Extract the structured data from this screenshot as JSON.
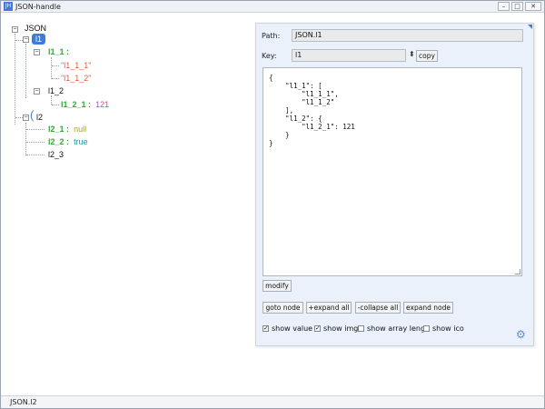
{
  "window": {
    "title": "JSON-handle",
    "icon_label": "JH",
    "buttons": {
      "minimize": "–",
      "maximize": "□",
      "close": "✕"
    }
  },
  "tree": {
    "root": "JSON",
    "l1_label": "l1",
    "l1_1": {
      "key": "l1_1",
      "colon": ":",
      "items": [
        "\"l1_1_1\"",
        "\"l1_1_2\""
      ]
    },
    "l1_2": {
      "label": "l1_2",
      "child_key": "l1_2_1",
      "colon": ":",
      "child_value": "121"
    },
    "l2_label": "l2",
    "l2_1": {
      "key": "l2_1",
      "colon": ":",
      "value": "null"
    },
    "l2_2": {
      "key": "l2_2",
      "colon": ":",
      "value": "true"
    },
    "l2_3": {
      "label": "l2_3"
    }
  },
  "panel": {
    "path_label": "Path:",
    "path_value": "JSON.l1",
    "key_label": "Key:",
    "key_value": "l1",
    "spin_glyph": "⬍",
    "copy_button": "copy",
    "editor_text": "{\n    \"l1_1\": [\n        \"l1_1_1\",\n        \"l1_1_2\"\n    ],\n    \"l1_2\": {\n        \"l1_2_1\": 121\n    }\n}",
    "modify_button": "modify",
    "goto_button": "goto node",
    "expand_all_button": "+expand all",
    "collapse_all_button": "-collapse all",
    "expand_node_button": "expand node",
    "checkboxes": [
      {
        "label": "show value",
        "checked": true
      },
      {
        "label": "show img",
        "checked": true
      },
      {
        "label": "show array leng",
        "checked": false
      },
      {
        "label": "show ico",
        "checked": false
      }
    ]
  },
  "statusbar": {
    "path": "JSON.l2"
  },
  "icons": {
    "expander_open": "⊟",
    "check": "✓",
    "gear": "⚙"
  },
  "colors": {
    "accent": "#3f7bd8",
    "key": "#3aa53a",
    "string": "#e05a3a",
    "number": "#c23fbf",
    "null": "#a2a32a",
    "bool": "#2e8fa0"
  }
}
